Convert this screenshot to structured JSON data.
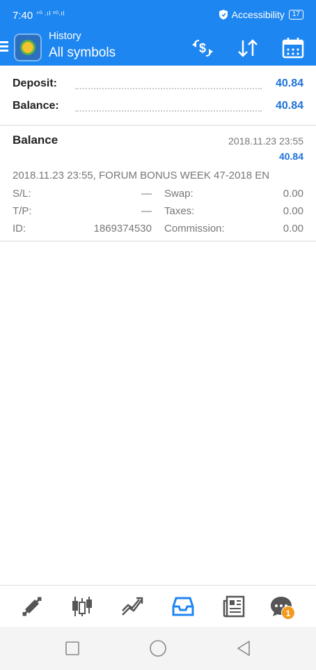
{
  "status_bar": {
    "time": "7:40",
    "network": "⁴ᴳ .ıl ²ᴳ.ıl",
    "accessibility": "Accessibility",
    "battery": "17"
  },
  "app_bar": {
    "subtitle": "History",
    "title": "All symbols",
    "actions": [
      "exchange-dollar-icon",
      "sort-icon",
      "calendar-icon"
    ]
  },
  "summary": {
    "deposit_label": "Deposit:",
    "deposit_value": "40.84",
    "balance_label": "Balance:",
    "balance_value": "40.84"
  },
  "deal": {
    "type": "Balance",
    "time": "2018.11.23 23:55",
    "profit": "40.84",
    "comment": "2018.11.23 23:55, FORUM BONUS WEEK 47-2018 EN",
    "sl_label": "S/L:",
    "sl_value": "—",
    "tp_label": "T/P:",
    "tp_value": "—",
    "id_label": "ID:",
    "id_value": "1869374530",
    "swap_label": "Swap:",
    "swap_value": "0.00",
    "taxes_label": "Taxes:",
    "taxes_value": "0.00",
    "commission_label": "Commission:",
    "commission_value": "0.00"
  },
  "bottom_nav": {
    "items": [
      "quotes-icon",
      "chart-icon",
      "trade-icon",
      "history-icon",
      "news-icon",
      "messages-icon"
    ],
    "active": "history-icon",
    "badge": "1",
    "accent": "#1e86f0"
  },
  "colors": {
    "accent": "#1e86f0",
    "value_blue": "#1d72d8",
    "badge_orange": "#f39a1e"
  }
}
